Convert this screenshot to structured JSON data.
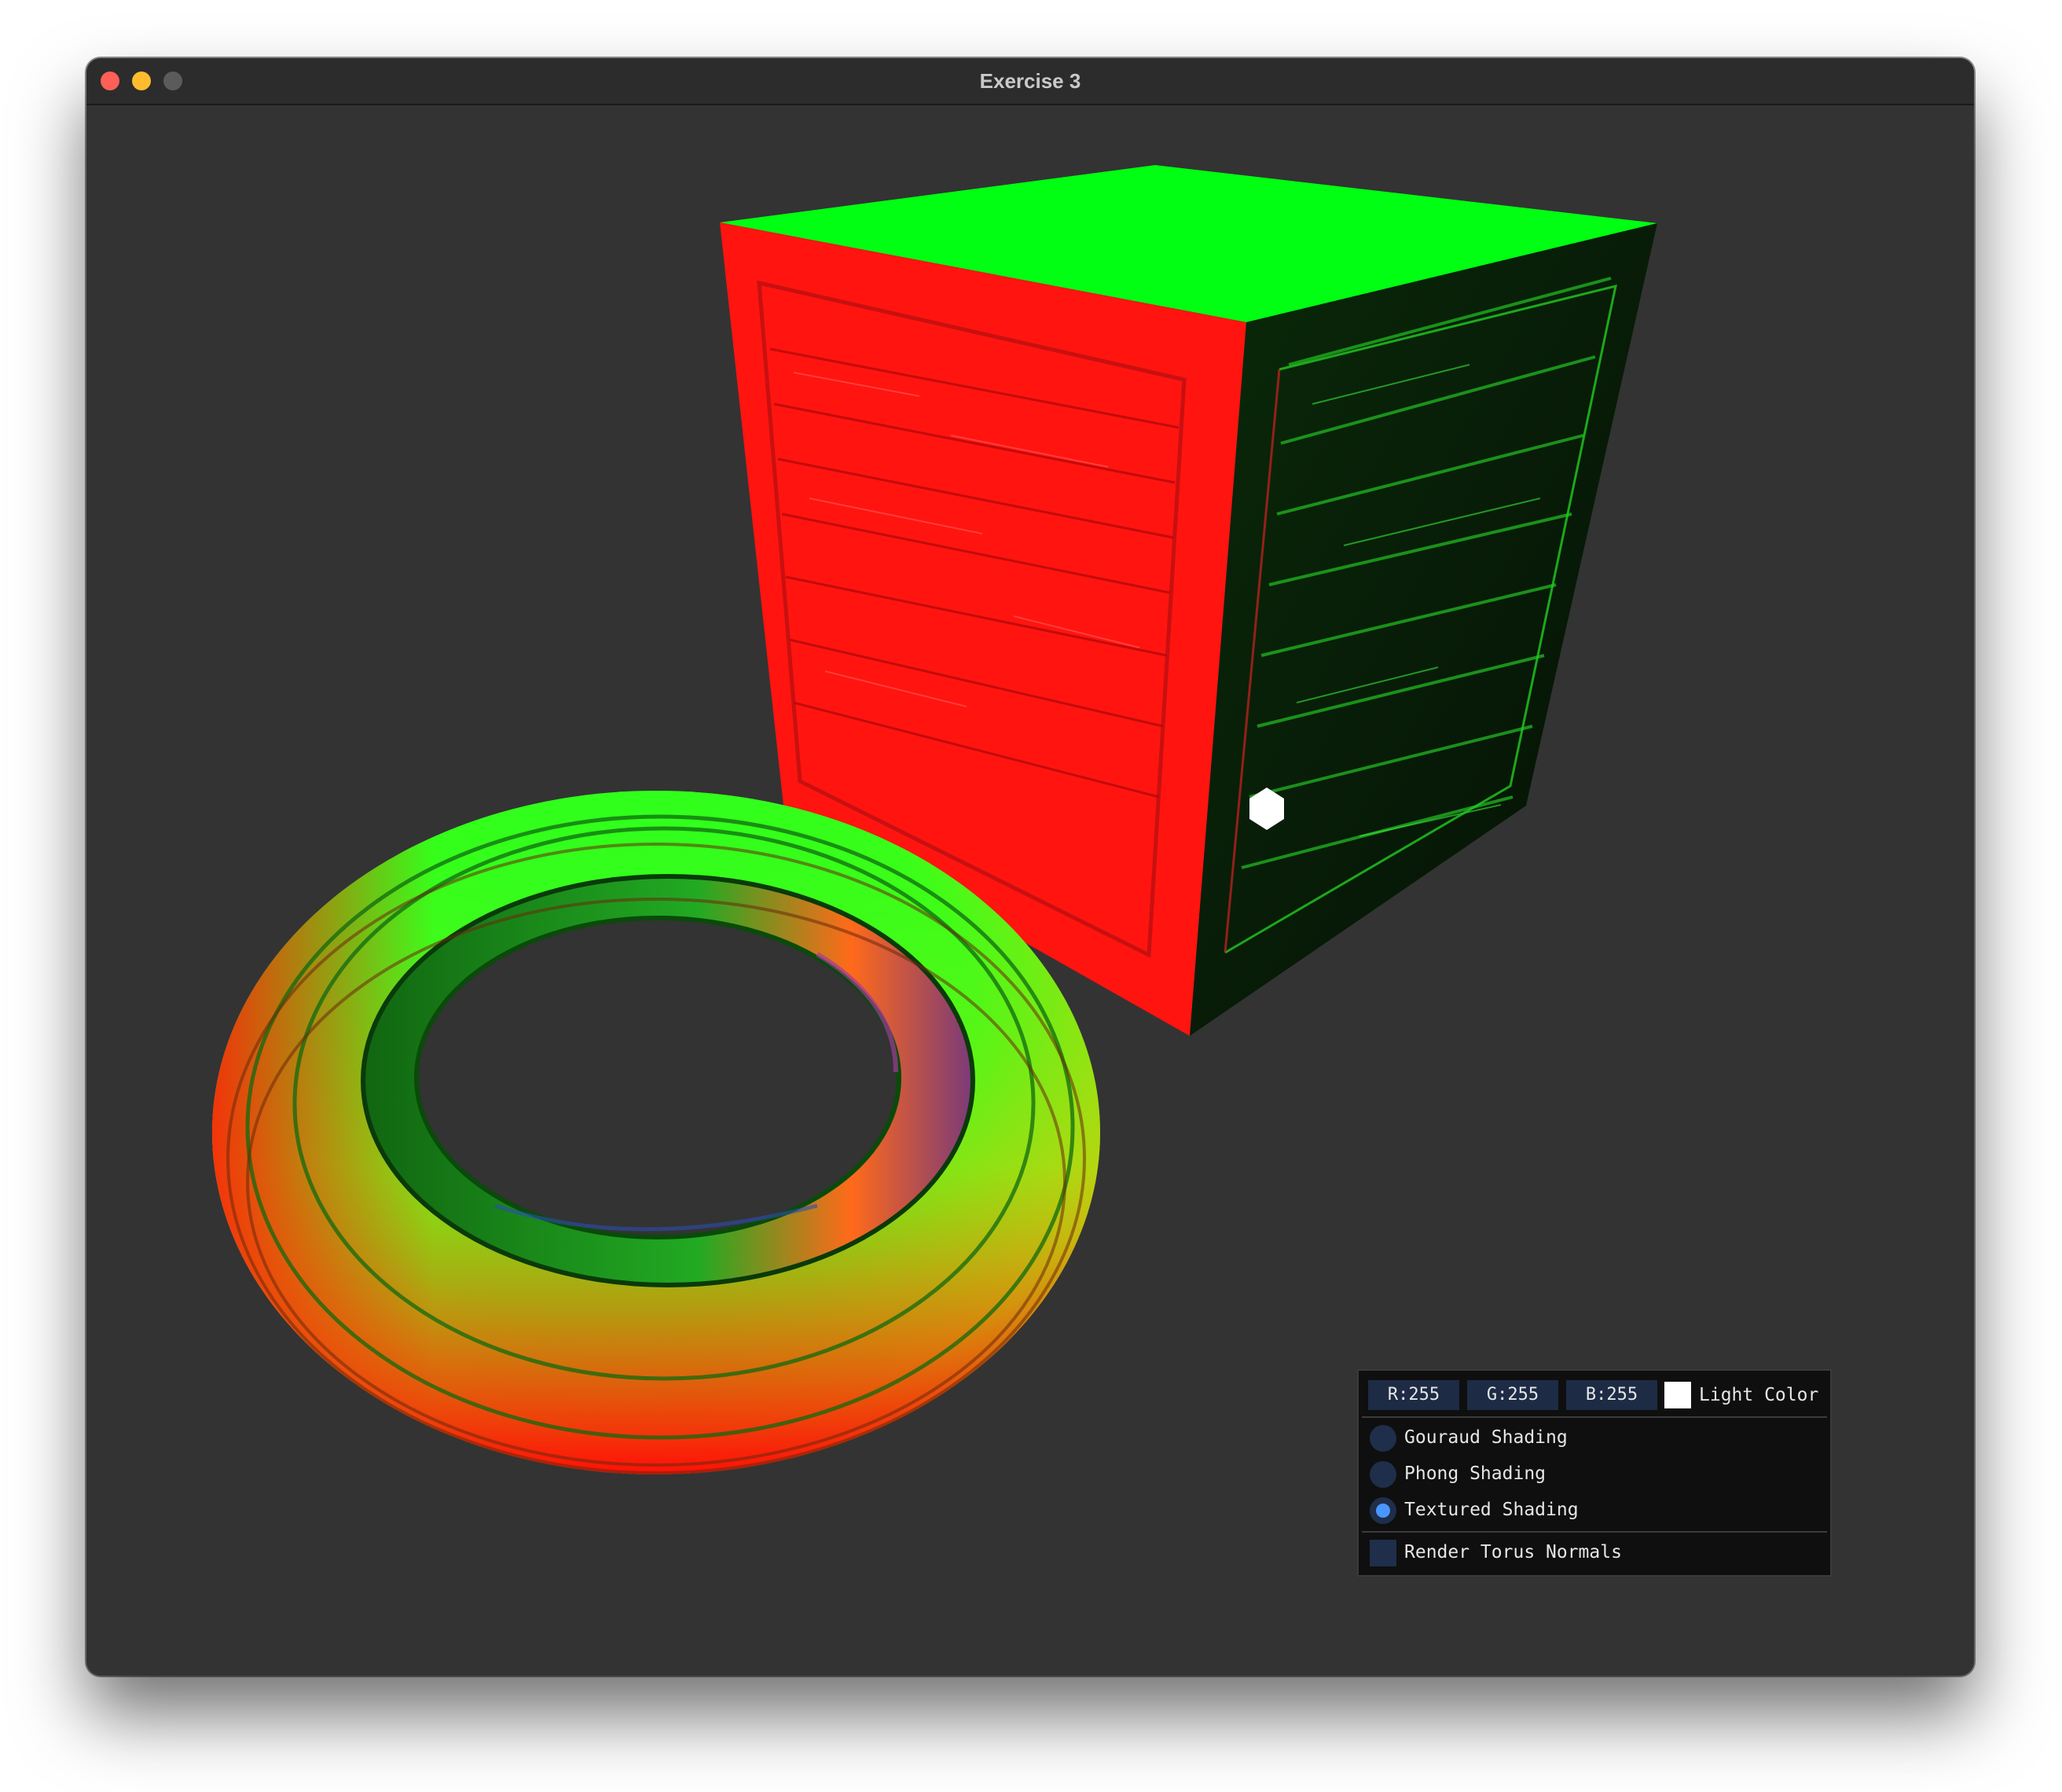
{
  "window": {
    "title": "Exercise 3",
    "controls": [
      "close",
      "minimize",
      "maximize"
    ]
  },
  "scene": {
    "objects": [
      "textured-cube",
      "textured-torus",
      "light-source"
    ],
    "colors": {
      "background": "#333333",
      "normal_red": "#ff1a10",
      "normal_green": "#00ff1a"
    }
  },
  "panel": {
    "light_color": {
      "r_label": "R:255",
      "g_label": "G:255",
      "b_label": "B:255",
      "swatch_color": "#ffffff",
      "label": "Light Color"
    },
    "shading": {
      "options": [
        {
          "label": "Gouraud Shading",
          "selected": false
        },
        {
          "label": "Phong Shading",
          "selected": false
        },
        {
          "label": "Textured Shading",
          "selected": true
        }
      ]
    },
    "render_torus_normals": {
      "label": "Render Torus Normals",
      "checked": false
    }
  }
}
